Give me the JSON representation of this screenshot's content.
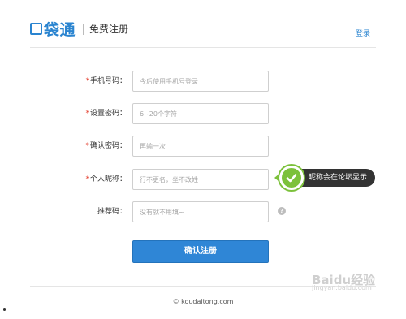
{
  "header": {
    "logo_text": "袋通",
    "page_title": "免费注册",
    "login_link": "登录"
  },
  "form": {
    "rows": [
      {
        "required": "*",
        "label": "手机号码：",
        "placeholder": "今后使用手机号登录"
      },
      {
        "required": "*",
        "label": "设置密码：",
        "placeholder": "6~20个字符"
      },
      {
        "required": "*",
        "label": "确认密码：",
        "placeholder": "再输一次"
      },
      {
        "required": "*",
        "label": "个人昵称：",
        "placeholder": "行不更名，坐不改姓"
      },
      {
        "required": "",
        "label": "推荐码：",
        "placeholder": "没有就不用填~"
      }
    ],
    "submit_label": "确认注册"
  },
  "tooltip": {
    "text": "昵称会在论坛显示",
    "check_icon": "checkmark-icon",
    "color": "#7cc13b"
  },
  "help_icon": {
    "glyph": "?",
    "icon": "question-icon"
  },
  "footer": {
    "copyright": "© koudaitong.com"
  },
  "watermark": {
    "main": "Baidu经验",
    "sub": "jingyan.baidu.com"
  },
  "colors": {
    "brand": "#2a84d0",
    "button": "#2f86d6",
    "required": "#e43f2f"
  }
}
